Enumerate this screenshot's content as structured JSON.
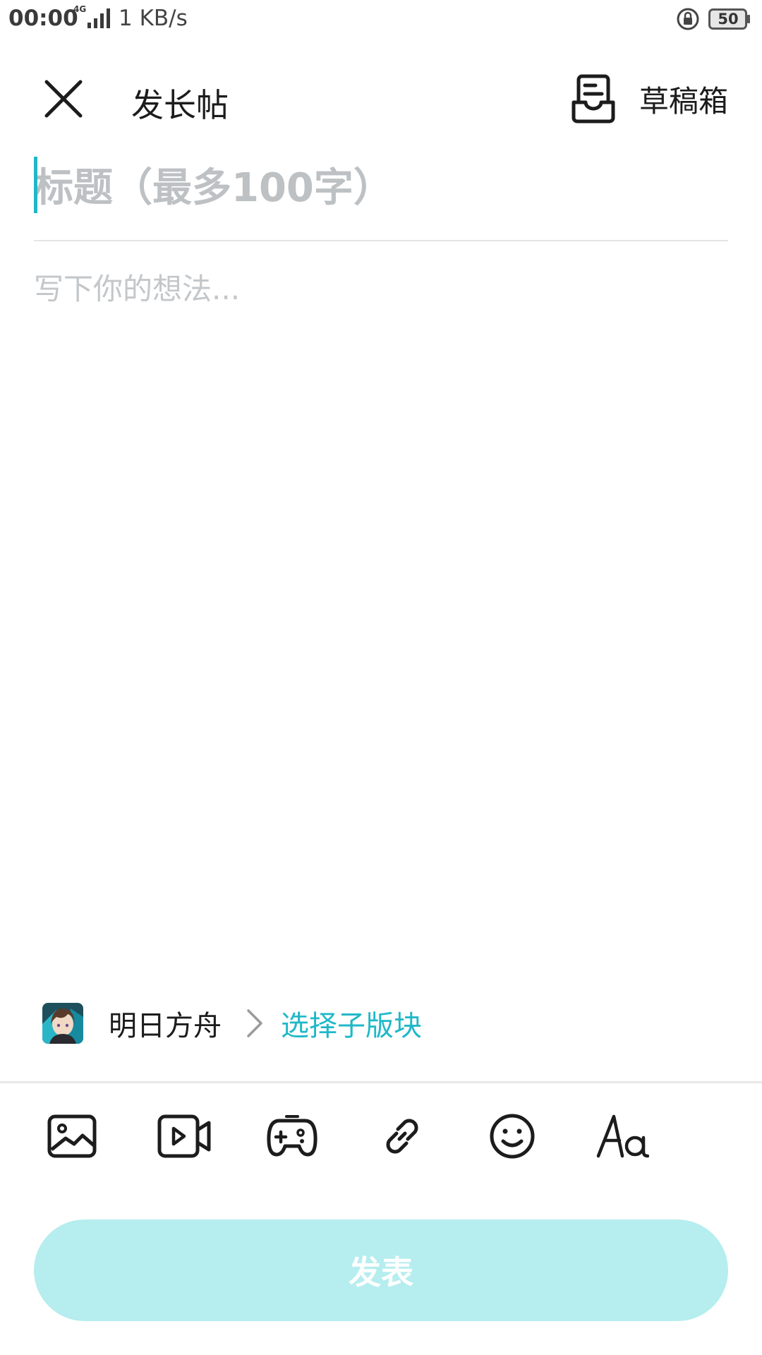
{
  "status_bar": {
    "time": "00:00",
    "network": "4G",
    "speed": "1 KB/s",
    "battery": "50"
  },
  "header": {
    "title": "发长帖",
    "drafts_label": "草稿箱"
  },
  "editor": {
    "title_placeholder": "标题（最多100字）",
    "body_placeholder": "写下你的想法..."
  },
  "forum": {
    "name": "明日方舟",
    "sub_forum_label": "选择子版块"
  },
  "toolbar": {
    "icons": [
      "image-icon",
      "video-icon",
      "gamepad-icon",
      "link-icon",
      "emoji-icon",
      "text-format-icon"
    ]
  },
  "publish": {
    "label": "发表"
  },
  "colors": {
    "accent": "#1fb8c8",
    "publish_disabled_bg": "#b6edee",
    "placeholder": "#bdc1c4"
  }
}
